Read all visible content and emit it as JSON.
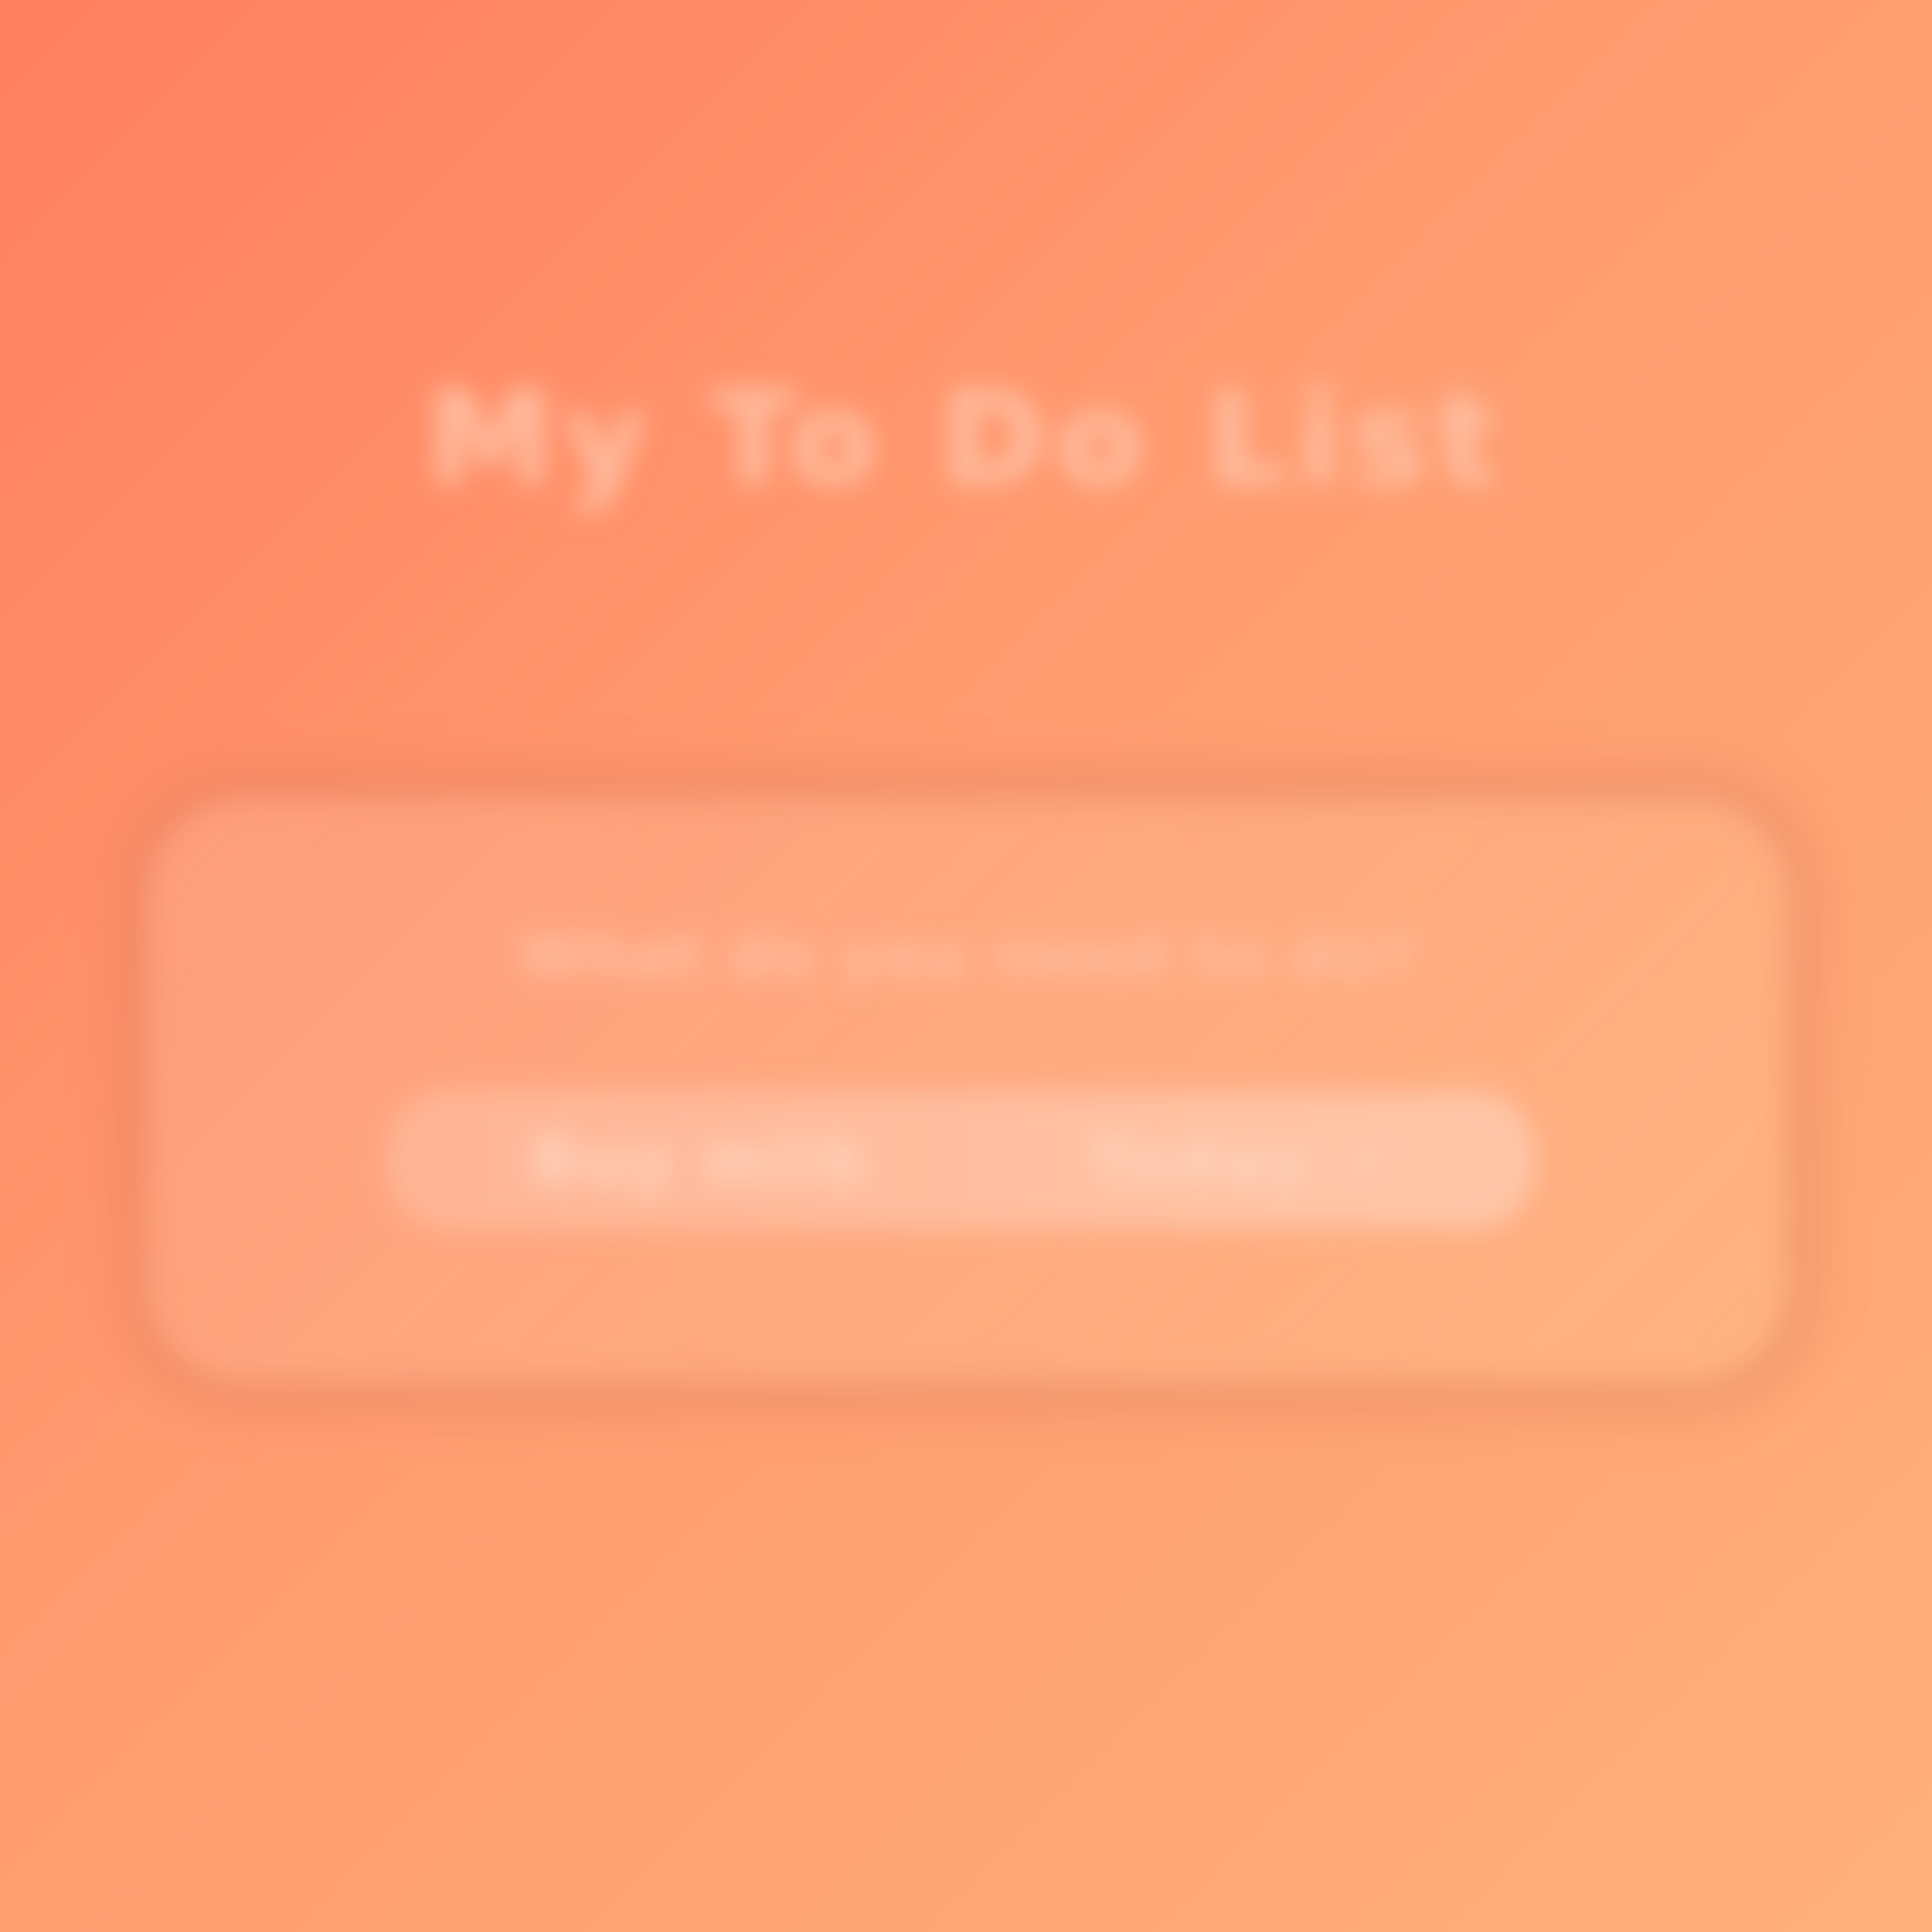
{
  "app": {
    "title": "My To Do List"
  },
  "panel": {
    "prompt": "What do you need to do?",
    "task": {
      "label": "Buy milk",
      "meta": "Today ✓"
    }
  },
  "colors": {
    "background_start": "#ff7f5e",
    "background_end": "#ffb07a",
    "panel_accent": "#ffb596"
  }
}
